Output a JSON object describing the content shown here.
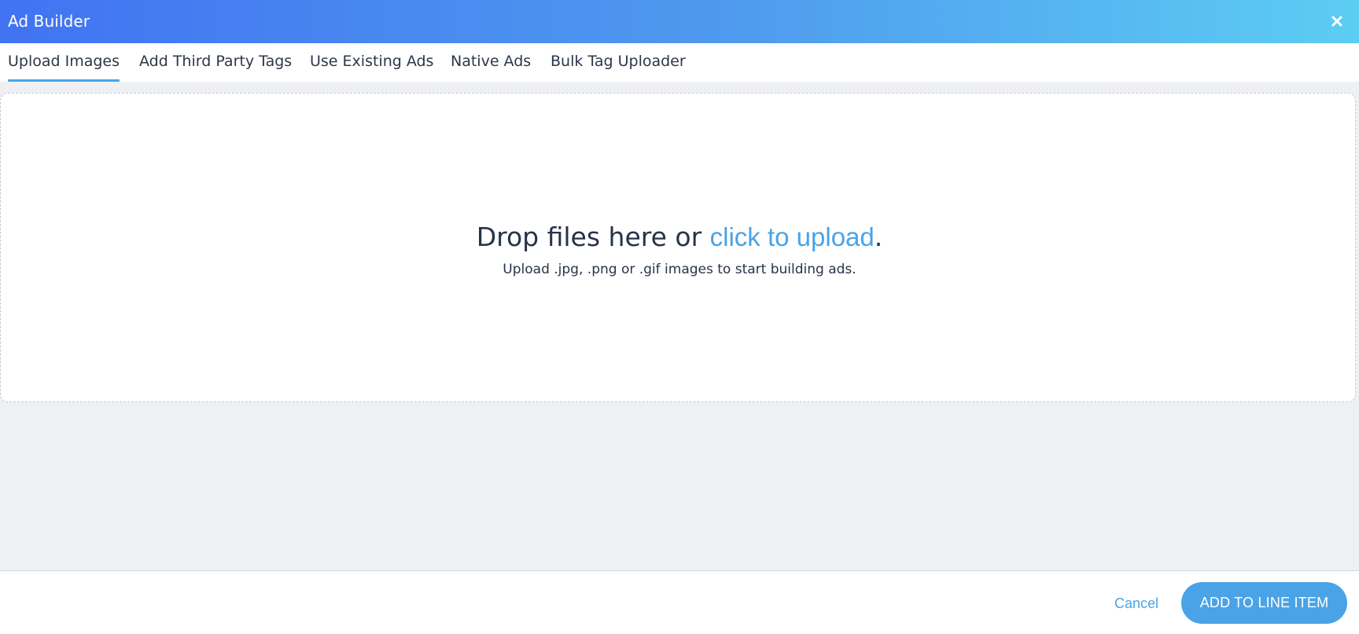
{
  "header": {
    "title": "Ad Builder",
    "close_icon": "close-icon"
  },
  "tabs": [
    {
      "label": "Upload Images",
      "active": true
    },
    {
      "label": "Add Third Party Tags",
      "active": false
    },
    {
      "label": "Use Existing Ads",
      "active": false
    },
    {
      "label": "Native Ads",
      "active": false
    },
    {
      "label": "Bulk Tag Uploader",
      "active": false
    }
  ],
  "dropzone": {
    "headline_prefix": "Drop files here or ",
    "link_label": "click to upload",
    "headline_suffix": ".",
    "subtext": "Upload .jpg, .png or .gif images to start building ads."
  },
  "footer": {
    "cancel_label": "Cancel",
    "primary_label": "ADD TO LINE ITEM"
  },
  "colors": {
    "header_gradient_start": "#4173f2",
    "header_gradient_end": "#5ccdf3",
    "accent": "#4aa3e6",
    "text": "#273349",
    "background": "#eef0f4"
  }
}
